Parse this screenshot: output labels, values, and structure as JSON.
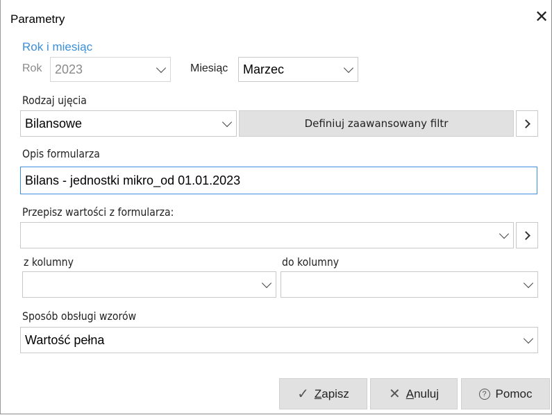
{
  "window": {
    "title": "Parametry",
    "close_glyph": "✕"
  },
  "section_year_month": {
    "heading": "Rok i miesiąc"
  },
  "year": {
    "label": "Rok",
    "value": "2023"
  },
  "month": {
    "label": "Miesiąc",
    "value": "Marzec"
  },
  "scope": {
    "label": "Rodzaj ujęcia",
    "value": "Bilansowe"
  },
  "filter_button": {
    "label": "Definiuj zaawansowany filtr"
  },
  "description": {
    "label": "Opis formularza",
    "value": "Bilans - jednostki mikro_od 01.01.2023"
  },
  "copy_from": {
    "label": "Przepisz wartości z formularza:",
    "value": ""
  },
  "from_column": {
    "label": "z kolumny",
    "value": ""
  },
  "to_column": {
    "label": "do kolumny",
    "value": ""
  },
  "formula_handling": {
    "label": "Sposób obsługi wzorów",
    "value": "Wartość pełna"
  },
  "footer": {
    "save_hotkey": "Z",
    "save_rest": "apisz",
    "cancel_hotkey": "A",
    "cancel_rest": "nuluj",
    "help_label": "Pomoc"
  },
  "icons": {
    "save": "checkmark-icon",
    "cancel": "x-icon",
    "help": "question-circle-icon"
  },
  "colors": {
    "accent": "#3b8fd9",
    "input_focus_border": "#3e8edb",
    "button_bg": "#e1e1e1"
  }
}
